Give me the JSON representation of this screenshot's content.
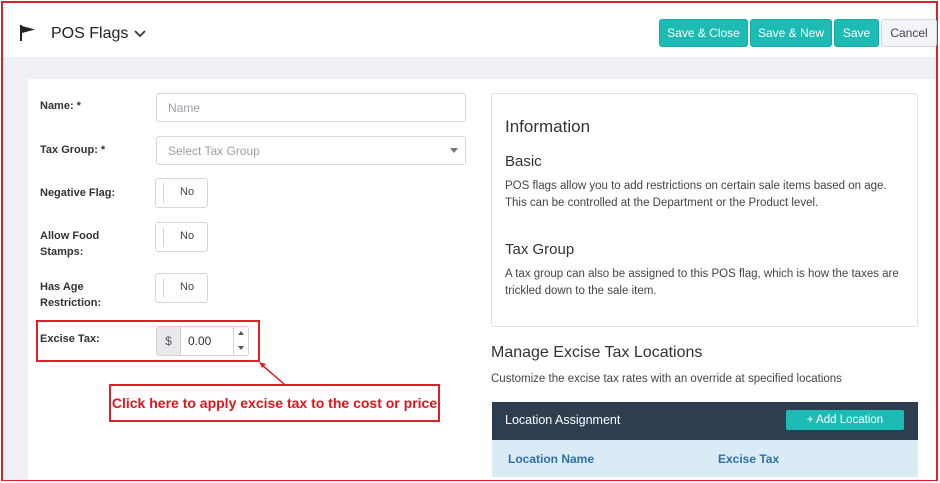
{
  "header": {
    "title": "POS Flags",
    "buttons": {
      "save_close": "Save & Close",
      "save_new": "Save & New",
      "save": "Save",
      "cancel": "Cancel"
    }
  },
  "form": {
    "name_label": "Name: *",
    "name_placeholder": "Name",
    "tax_group_label": "Tax Group: *",
    "tax_group_placeholder": "Select Tax Group",
    "negative_flag_label": "Negative Flag:",
    "negative_flag_value": "No",
    "food_stamps_label_1": "Allow Food",
    "food_stamps_label_2": "Stamps:",
    "food_stamps_value": "No",
    "age_label_1": "Has Age",
    "age_label_2": "Restriction:",
    "age_value": "No",
    "excise_label": "Excise Tax:",
    "excise_currency": "$",
    "excise_value": "0.00"
  },
  "annotation": {
    "callout": "Click here to apply excise tax to the cost or price"
  },
  "info": {
    "title": "Information",
    "basic_heading": "Basic",
    "basic_text": "POS flags allow you to add restrictions on certain sale items based on age. This can be controlled at the Department or the Product level.",
    "tax_heading": "Tax Group",
    "tax_text": "A tax group can also be assigned to this POS flag, which is how the taxes are trickled down to the sale item."
  },
  "excise_locations": {
    "title": "Manage Excise Tax Locations",
    "description": "Customize the excise tax rates with an override at specified locations",
    "table_title": "Location Assignment",
    "add_button": "+ Add Location",
    "columns": [
      "Location Name",
      "Excise Tax"
    ]
  },
  "colors": {
    "accent": "#1cbcb4",
    "annotation_red": "#d9232a",
    "table_header": "#2e3e51",
    "column_header_bg": "#d9ecf6"
  }
}
